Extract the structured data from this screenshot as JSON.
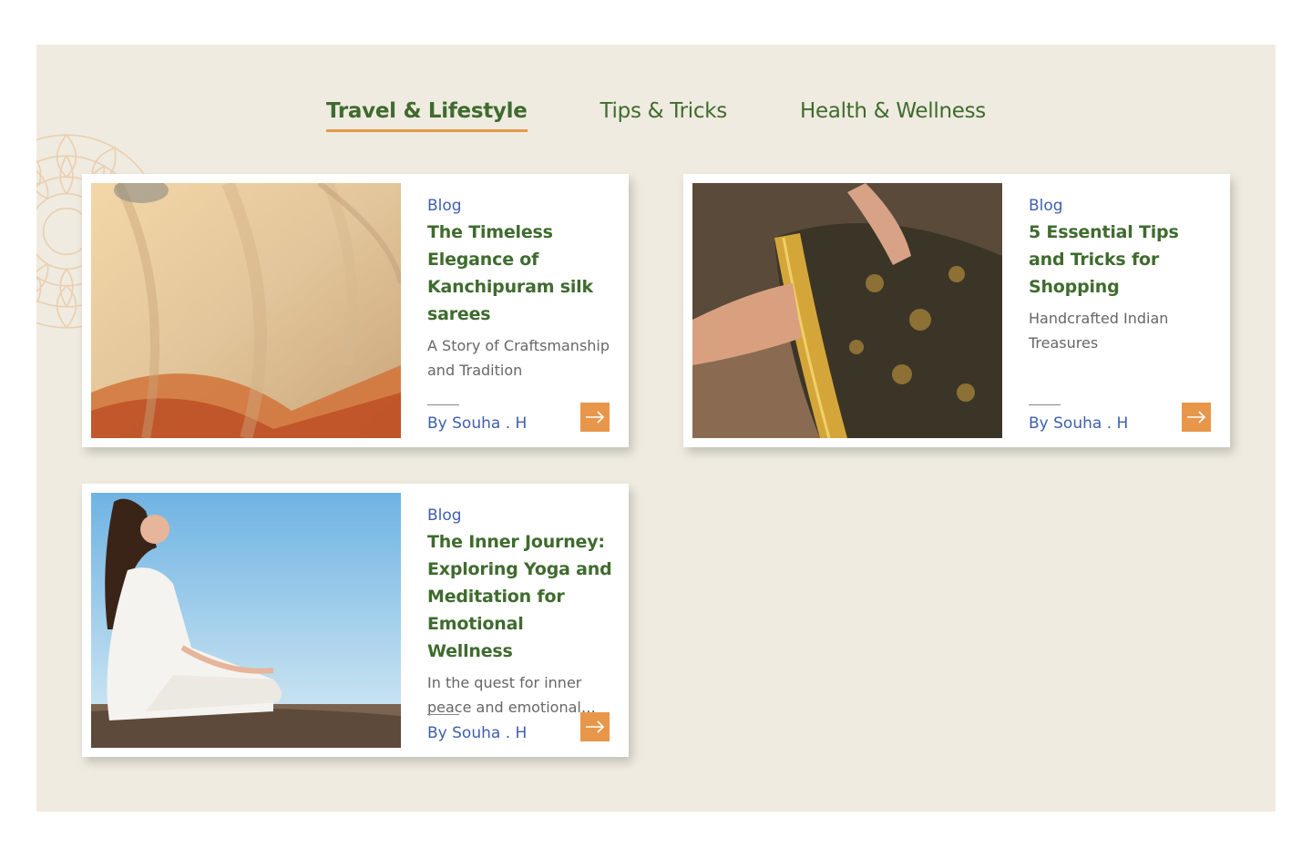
{
  "tabs": [
    {
      "label": "Travel & Lifestyle",
      "active": true
    },
    {
      "label": "Tips & Tricks",
      "active": false
    },
    {
      "label": "Health & Wellness",
      "active": false
    }
  ],
  "cards": [
    {
      "category": "Blog",
      "title": "The Timeless Elegance of Kanchipuram silk sarees",
      "description": "A Story of Craftsmanship and Tradition",
      "author": "By Souha . H",
      "image": "silk-saree-photo"
    },
    {
      "category": "Blog",
      "title": "5 Essential Tips and Tricks for Shopping",
      "description": "Handcrafted Indian Treasures",
      "author": "By Souha . H",
      "image": "embroidered-fabric-photo"
    },
    {
      "category": "Blog",
      "title": "The Inner Journey: Exploring Yoga and Meditation for Emotional Wellness",
      "description": "In the quest for inner peace and emotional well-being",
      "author": "By Souha . H",
      "image": "yoga-meditation-photo"
    }
  ],
  "icons": {
    "read_more": "arrow-right-icon",
    "decoration": "mandala-icon"
  },
  "colors": {
    "background": "#efebe0",
    "green": "#3f6b2e",
    "blue": "#3f5fae",
    "accent": "#e8964a",
    "text_muted": "#666666"
  }
}
